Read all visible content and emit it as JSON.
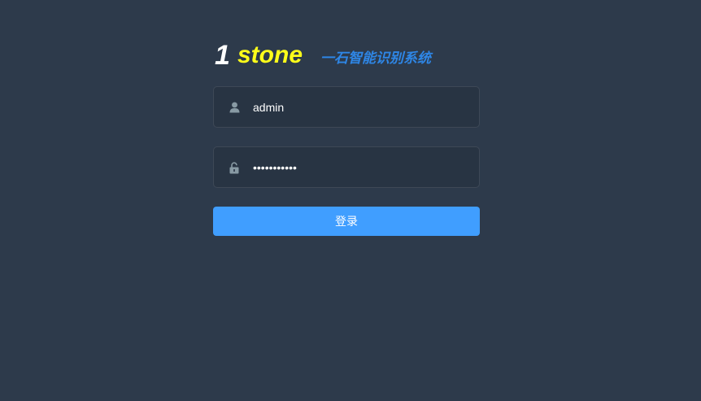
{
  "branding": {
    "logo_number": "1",
    "logo_word": "stone",
    "subtitle": "一石智能识别系统"
  },
  "login_form": {
    "username": {
      "icon": "user-icon",
      "value": "admin"
    },
    "password": {
      "icon": "lock-icon",
      "masked_value": "•••••••••••"
    },
    "submit_label": "登录"
  },
  "colors": {
    "background": "#2d3a4b",
    "logo_number": "#ffffff",
    "logo_word": "#ffff1a",
    "subtitle": "#2e86e6",
    "button": "#409eff",
    "icon": "#889aa4"
  }
}
